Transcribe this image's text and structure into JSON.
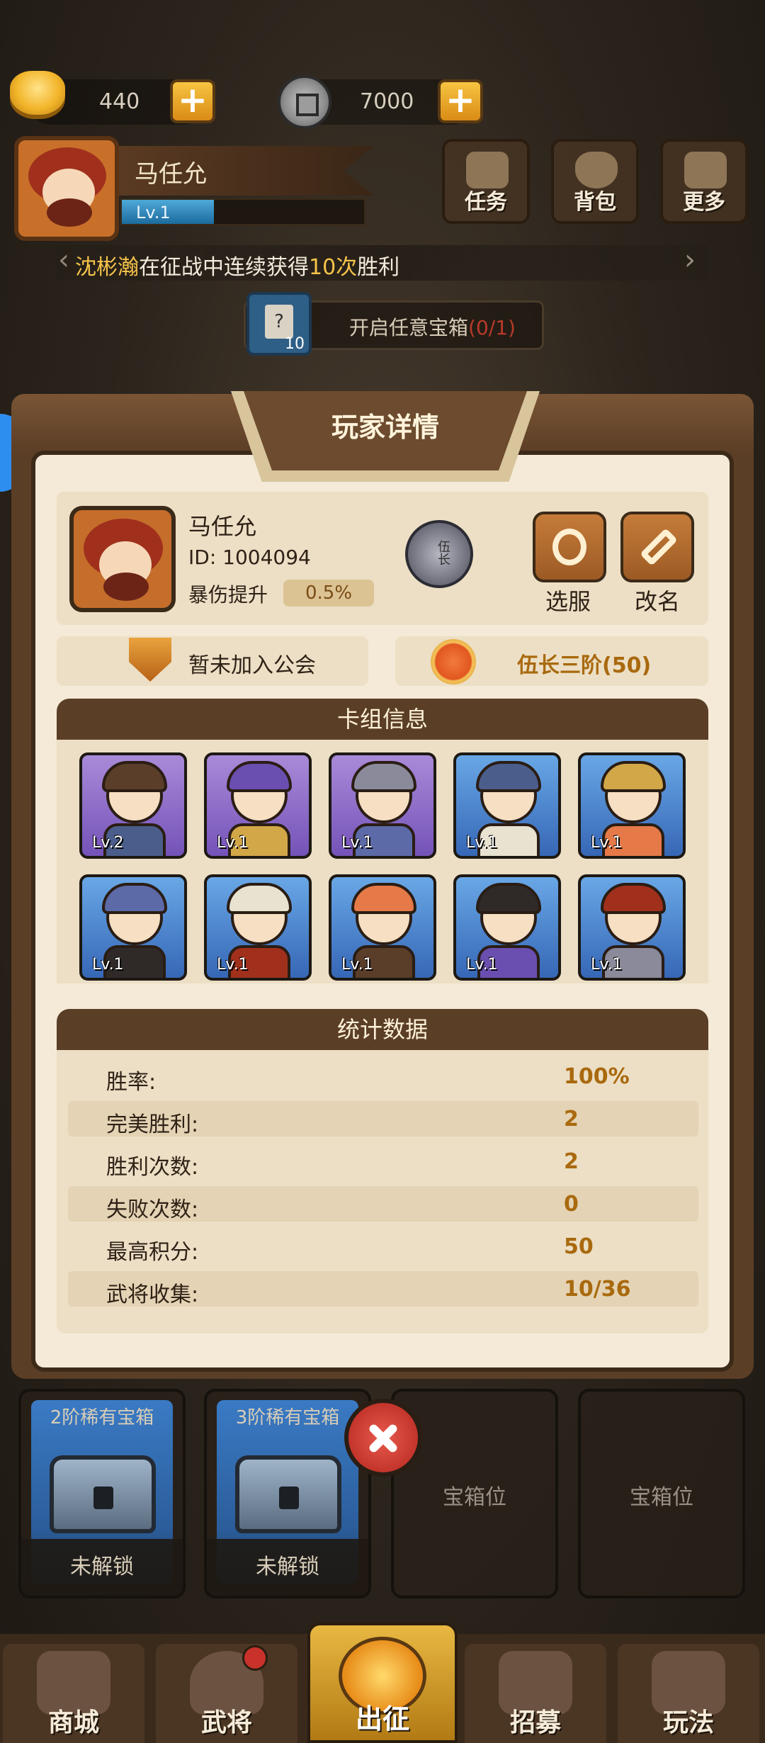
{
  "resources": {
    "gold": "440",
    "coins": "7000"
  },
  "player_bar": {
    "name": "马任允",
    "level": "Lv.1",
    "level_progress": 0.38
  },
  "top_buttons": [
    {
      "label": "任务"
    },
    {
      "label": "背包"
    },
    {
      "label": "更多"
    }
  ],
  "news": {
    "name": "沈彬瀚",
    "mid": "在征战中连续获得",
    "count": "10次",
    "end": "胜利"
  },
  "chest_task": {
    "card_count": "10",
    "card_mark": "?",
    "text": "开启任意宝箱",
    "progress": "(0/1)"
  },
  "modal": {
    "title": "玩家详情",
    "player": {
      "name": "马任允",
      "id": "ID: 1004094",
      "crit_label": "暴伤提升",
      "crit_value": "0.5%",
      "rank_badge_text": "伍长",
      "server_btn": "选服",
      "rename_btn": "改名"
    },
    "guild": "暂未加入公会",
    "rank": "伍长三阶(50)",
    "deck_title": "卡组信息",
    "deck": [
      {
        "level": "Lv.2",
        "rarity": "purple"
      },
      {
        "level": "Lv.1",
        "rarity": "purple"
      },
      {
        "level": "Lv.1",
        "rarity": "purple"
      },
      {
        "level": "Lv.1",
        "rarity": "blue"
      },
      {
        "level": "Lv.1",
        "rarity": "blue"
      },
      {
        "level": "Lv.1",
        "rarity": "blue"
      },
      {
        "level": "Lv.1",
        "rarity": "blue"
      },
      {
        "level": "Lv.1",
        "rarity": "blue"
      },
      {
        "level": "Lv.1",
        "rarity": "blue"
      },
      {
        "level": "Lv.1",
        "rarity": "blue"
      }
    ],
    "stats_title": "统计数据",
    "stats": [
      {
        "label": "胜率:",
        "value": "100%"
      },
      {
        "label": "完美胜利:",
        "value": "2"
      },
      {
        "label": "胜利次数:",
        "value": "2"
      },
      {
        "label": "失败次数:",
        "value": "0"
      },
      {
        "label": "最高积分:",
        "value": "50"
      },
      {
        "label": "武将收集:",
        "value": "10/36"
      }
    ]
  },
  "chest_slots": [
    {
      "title": "2阶稀有宝箱",
      "status": "未解锁"
    },
    {
      "title": "3阶稀有宝箱",
      "status": "未解锁"
    },
    {
      "label": "宝箱位"
    },
    {
      "label": "宝箱位"
    }
  ],
  "nav": [
    {
      "label": "商城"
    },
    {
      "label": "武将"
    },
    {
      "label": "出征"
    },
    {
      "label": "招募"
    },
    {
      "label": "玩法"
    }
  ],
  "colors": {
    "accent_gold": "#f6c44a",
    "rank_text": "#a9690e",
    "progress_red": "#b83a2a",
    "modal_brown": "#5b3e26"
  }
}
